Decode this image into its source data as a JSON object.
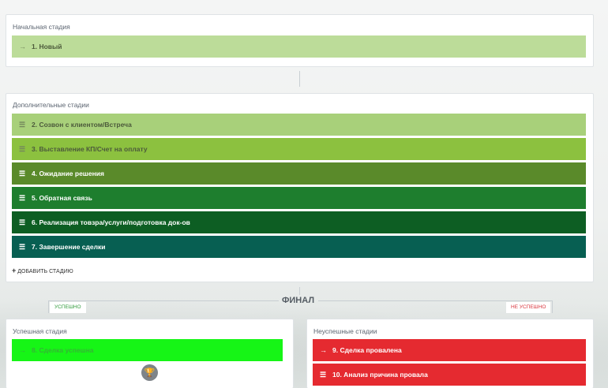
{
  "initial": {
    "title": "Начальная стадия",
    "stage": {
      "icon": "arrow-right-icon",
      "label": "1. Новый",
      "color": "#bcdc99"
    }
  },
  "additional": {
    "title": "Дополнительные стадии",
    "stages": [
      {
        "label": "2. Созвон с клиентом/Встреча",
        "color": "#a8d07a"
      },
      {
        "label": "3. Выставление КП/Счет на оплату",
        "color": "#8cc13f"
      },
      {
        "label": "4. Ожидание решения",
        "color": "#5a8a2a"
      },
      {
        "label": "5. Обратная связь",
        "color": "#1e7e2e"
      },
      {
        "label": "6. Реализация товзра/услуги/подготовка док-ов",
        "color": "#0d5e23"
      },
      {
        "label": "7. Завершение сделки",
        "color": "#075f52"
      }
    ],
    "add_label": "ДОБАВИТЬ СТАДИЮ",
    "add_symbol": "+"
  },
  "final": {
    "title": "ФИНАЛ",
    "success_tag": "УСПЕШНО",
    "fail_tag": "НЕ УСПЕШНО",
    "success_color": "#2f9a3a",
    "fail_color": "#d8333b"
  },
  "success_panel": {
    "title": "Успешная стадия",
    "stage": {
      "label": "8. Сделка успешна",
      "color": "#16f516"
    },
    "icon": "trophy-icon"
  },
  "fail_panel": {
    "title": "Неуспешные стадии",
    "stages": [
      {
        "icon": "arrow-right-icon",
        "label": "9. Сделка провалена",
        "color": "#e52a30"
      },
      {
        "icon": "drag-handle-icon",
        "label": "10. Анализ причина провала",
        "color": "#e52a30"
      }
    ]
  }
}
